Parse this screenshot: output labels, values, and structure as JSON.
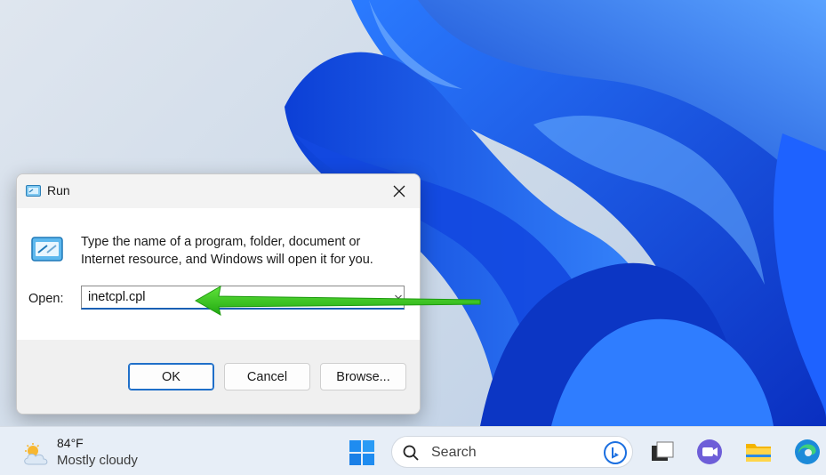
{
  "dialog": {
    "title": "Run",
    "description": "Type the name of a program, folder, document or Internet resource, and Windows will open it for you.",
    "open_label": "Open:",
    "input_value": "inetcpl.cpl",
    "buttons": {
      "ok": "OK",
      "cancel": "Cancel",
      "browse": "Browse..."
    }
  },
  "taskbar": {
    "weather": {
      "temperature": "84°F",
      "condition": "Mostly cloudy",
      "icon": "partly-cloudy-icon"
    },
    "search_placeholder": "Search",
    "icons": [
      "windows-start-icon",
      "search-icon",
      "bing-chat-icon",
      "task-view-icon",
      "teams-chat-icon",
      "file-explorer-icon",
      "edge-icon"
    ]
  },
  "annotation": {
    "type": "arrow",
    "color": "#36c51b",
    "points_to": "open-input"
  },
  "colors": {
    "accent": "#1a5fb4",
    "arrow": "#36c51b",
    "wallpaper": "#1f5fe6"
  }
}
